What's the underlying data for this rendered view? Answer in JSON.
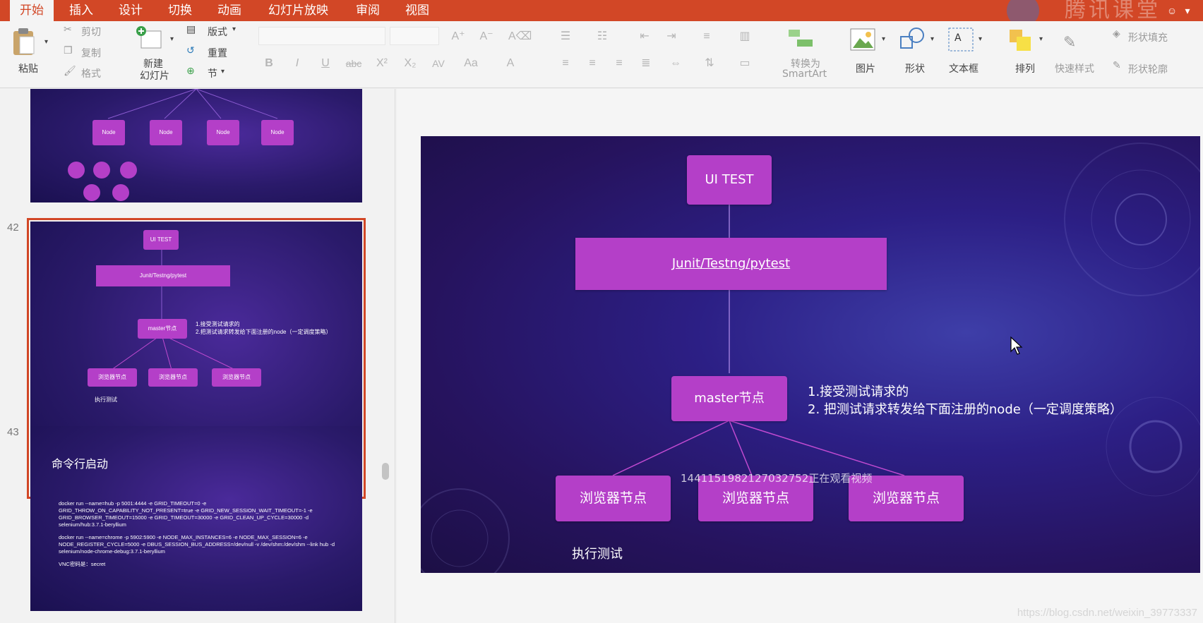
{
  "ribbon_tabs": [
    "开始",
    "插入",
    "设计",
    "切换",
    "动画",
    "幻灯片放映",
    "审阅",
    "视图"
  ],
  "active_tab": "开始",
  "brand_text": "腾讯课堂",
  "ribbon": {
    "paste": "粘贴",
    "cut": "剪切",
    "copy": "复制",
    "format": "格式",
    "new_slide_line1": "新建",
    "new_slide_line2": "幻灯片",
    "layout": "版式",
    "reset": "重置",
    "section": "节",
    "smartart_line1": "转换为",
    "smartart_line2": "SmartArt",
    "picture": "图片",
    "shapes": "形状",
    "textbox": "文本框",
    "arrange": "排列",
    "quick_styles": "快速样式",
    "shape_fill": "形状填充",
    "shape_outline": "形状轮廓"
  },
  "thumbnails": {
    "first": {
      "node_label": "Node"
    },
    "s42": {
      "number": "42",
      "ui_test": "UI TEST",
      "junit": "Junit/Testng/pytest",
      "master": "master节点",
      "note1": "1.接受测试请求的",
      "note2": "2.把测试请求转发给下面注册的node（一定调度策略）",
      "browser_node": "浏览器节点",
      "run": "执行测试"
    },
    "s43": {
      "number": "43",
      "title": "命令行启动",
      "b1": "docker run --name=hub -p 5001:4444 -e GRID_TIMEOUT=0 -e GRID_THROW_ON_CAPABILITY_NOT_PRESENT=true -e GRID_NEW_SESSION_WAIT_TIMEOUT=-1 -e GRID_BROWSER_TIMEOUT=15000 -e GRID_TIMEOUT=30000 -e GRID_CLEAN_UP_CYCLE=30000 -d selenium/hub:3.7.1-beryllium",
      "b2": "docker run --name=chrome -p 5902:5900 -e NODE_MAX_INSTANCES=6 -e NODE_MAX_SESSION=6 -e NODE_REGISTER_CYCLE=5000 -e DBUS_SESSION_BUS_ADDRESS=/dev/null -v /dev/shm:/dev/shm --link hub -d selenium/node-chrome-debug:3.7.1-beryllium",
      "b3": "VNC密码是：secret"
    }
  },
  "slide": {
    "ui_test": "UI TEST",
    "junit": "Junit/Testng/pytest",
    "master": "master节点",
    "note1": "1.接受测试请求的",
    "note2": "2. 把测试请求转发给下面注册的node（一定调度策略）",
    "browser_node": "浏览器节点",
    "run": "执行测试",
    "viewer_overlay": "1441151982127032752正在观看视频"
  },
  "watermark": "https://blog.csdn.net/weixin_39773337",
  "colors": {
    "ribbon_red": "#d24726",
    "box_purple": "#b43fc8"
  }
}
